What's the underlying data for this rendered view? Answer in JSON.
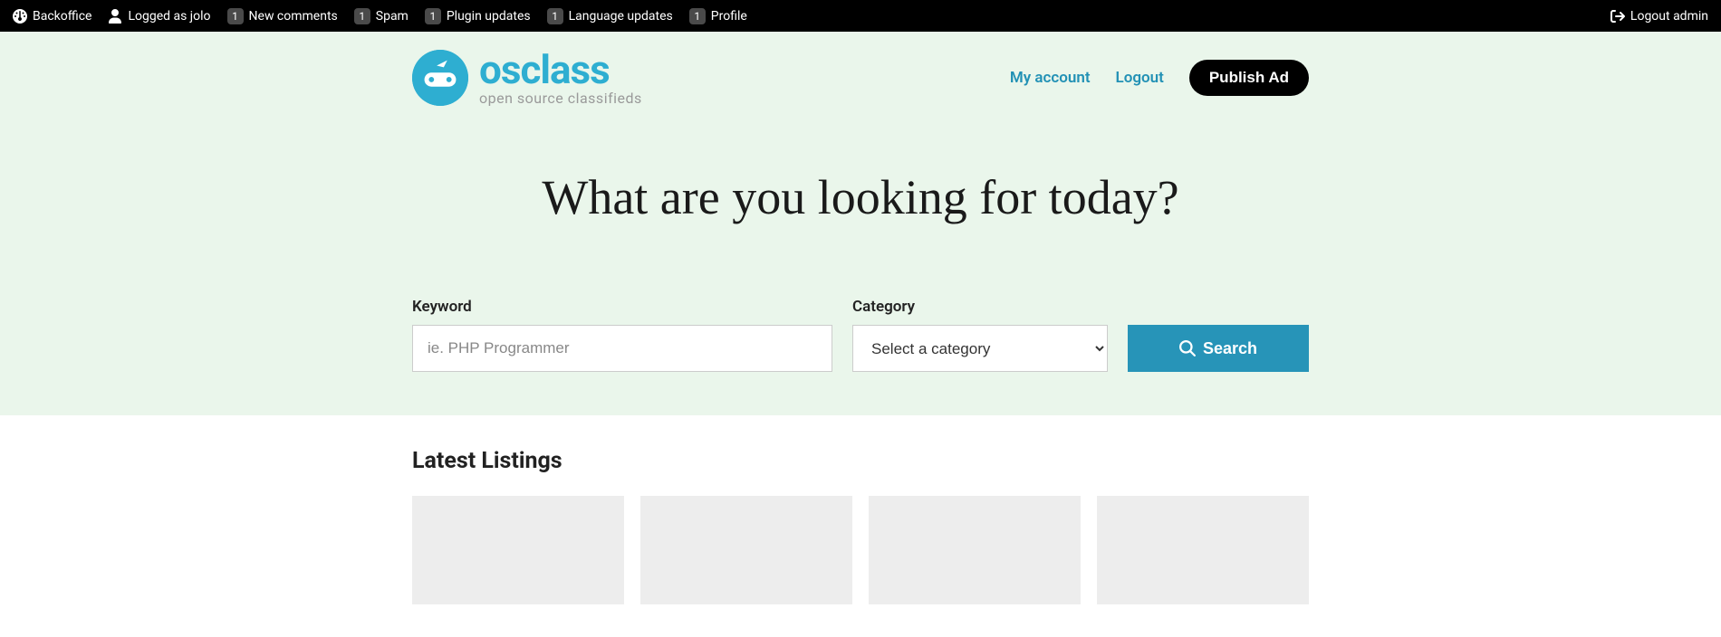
{
  "adminbar": {
    "backoffice": "Backoffice",
    "logged_as": "Logged as jolo",
    "items": [
      {
        "badge": "1",
        "label": "New comments"
      },
      {
        "badge": "1",
        "label": "Spam"
      },
      {
        "badge": "1",
        "label": "Plugin updates"
      },
      {
        "badge": "1",
        "label": "Language updates"
      },
      {
        "badge": "1",
        "label": "Profile"
      }
    ],
    "logout": "Logout admin"
  },
  "brand": {
    "name": "osclass",
    "tagline": "open source classifieds"
  },
  "nav": {
    "my_account": "My account",
    "logout": "Logout",
    "publish": "Publish Ad"
  },
  "hero": {
    "title": "What are you looking for today?"
  },
  "search": {
    "keyword_label": "Keyword",
    "keyword_placeholder": "ie. PHP Programmer",
    "category_label": "Category",
    "category_selected": "Select a category",
    "button": "Search"
  },
  "listings": {
    "title": "Latest Listings"
  }
}
